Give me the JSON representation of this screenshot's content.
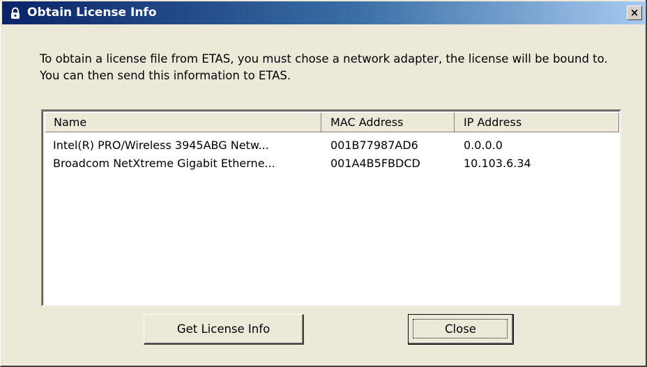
{
  "window": {
    "title": "Obtain License Info",
    "close_glyph": "×",
    "title_icon": "padlock-icon"
  },
  "intro_text": "To obtain a license file from ETAS, you must chose a network adapter, the license will be bound to. You can then send this information to ETAS.",
  "adapters": {
    "columns": [
      "Name",
      "MAC Address",
      "IP Address"
    ],
    "rows": [
      {
        "name": "Intel(R) PRO/Wireless 3945ABG Netw...",
        "mac": "001B77987AD6",
        "ip": "0.0.0.0"
      },
      {
        "name": "Broadcom NetXtreme Gigabit Etherne...",
        "mac": "001A4B5FBDCD",
        "ip": "10.103.6.34"
      }
    ]
  },
  "buttons": {
    "get_license": "Get License Info",
    "close": "Close"
  },
  "colors": {
    "titlebar_start": "#0a246a",
    "titlebar_end": "#a6caf0",
    "dialog_face": "#ece9d8"
  }
}
